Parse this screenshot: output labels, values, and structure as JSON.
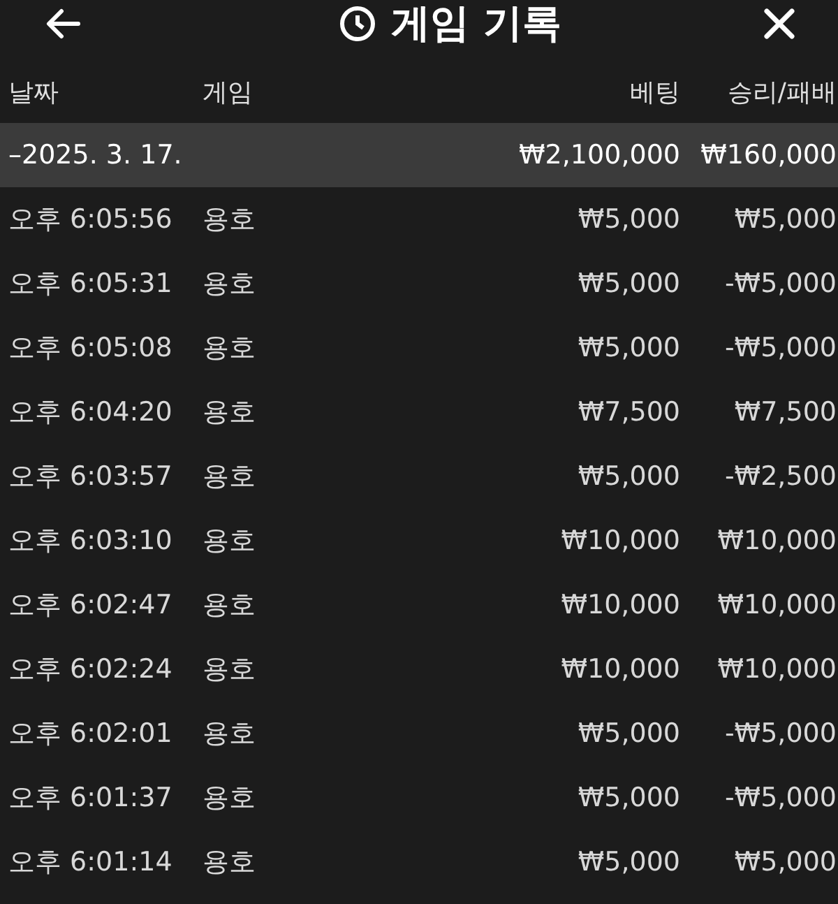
{
  "title": "게임 기록",
  "columns": [
    "날짜",
    "게임",
    "베팅",
    "승리/패배"
  ],
  "group": {
    "toggle": "–",
    "date": "2025. 3. 17.",
    "bet": "₩2,100,000",
    "result": "₩160,000"
  },
  "rows": [
    {
      "time": "오후 6:05:56",
      "game": "용호",
      "bet": "₩5,000",
      "result": "₩5,000"
    },
    {
      "time": "오후 6:05:31",
      "game": "용호",
      "bet": "₩5,000",
      "result": "-₩5,000"
    },
    {
      "time": "오후 6:05:08",
      "game": "용호",
      "bet": "₩5,000",
      "result": "-₩5,000"
    },
    {
      "time": "오후 6:04:20",
      "game": "용호",
      "bet": "₩7,500",
      "result": "₩7,500"
    },
    {
      "time": "오후 6:03:57",
      "game": "용호",
      "bet": "₩5,000",
      "result": "-₩2,500"
    },
    {
      "time": "오후 6:03:10",
      "game": "용호",
      "bet": "₩10,000",
      "result": "₩10,000"
    },
    {
      "time": "오후 6:02:47",
      "game": "용호",
      "bet": "₩10,000",
      "result": "₩10,000"
    },
    {
      "time": "오후 6:02:24",
      "game": "용호",
      "bet": "₩10,000",
      "result": "₩10,000"
    },
    {
      "time": "오후 6:02:01",
      "game": "용호",
      "bet": "₩5,000",
      "result": "-₩5,000"
    },
    {
      "time": "오후 6:01:37",
      "game": "용호",
      "bet": "₩5,000",
      "result": "-₩5,000"
    },
    {
      "time": "오후 6:01:14",
      "game": "용호",
      "bet": "₩5,000",
      "result": "₩5,000"
    }
  ]
}
